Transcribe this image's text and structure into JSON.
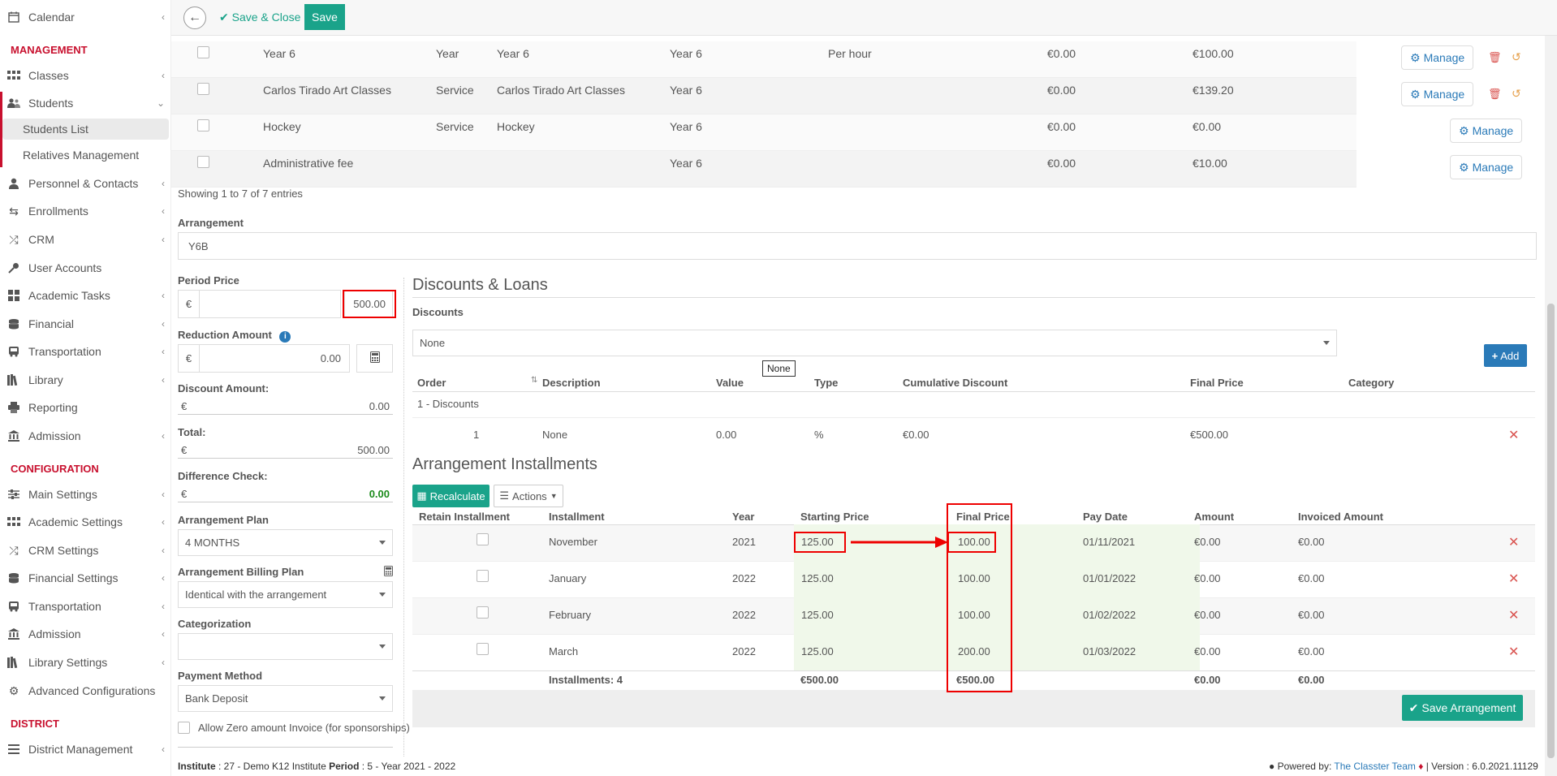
{
  "sidebar": {
    "sections": {
      "management": "MANAGEMENT",
      "configuration": "CONFIGURATION",
      "district": "DISTRICT"
    },
    "items": [
      {
        "label": "Calendar",
        "icon": "calendar-icon",
        "chevron": true
      },
      {
        "label": "Classes",
        "icon": "classes-icon",
        "chevron": true
      },
      {
        "label": "Students",
        "icon": "users-icon",
        "chevron": true
      },
      {
        "label": "Personnel & Contacts",
        "icon": "person-icon",
        "chevron": true
      },
      {
        "label": "Enrollments",
        "icon": "exchange-icon",
        "chevron": true
      },
      {
        "label": "CRM",
        "icon": "shuffle-icon",
        "chevron": true
      },
      {
        "label": "User Accounts",
        "icon": "key-icon",
        "chevron": false
      },
      {
        "label": "Academic Tasks",
        "icon": "grid-icon",
        "chevron": true
      },
      {
        "label": "Financial",
        "icon": "coins-icon",
        "chevron": true
      },
      {
        "label": "Transportation",
        "icon": "bus-icon",
        "chevron": true
      },
      {
        "label": "Library",
        "icon": "library-icon",
        "chevron": true
      },
      {
        "label": "Reporting",
        "icon": "printer-icon",
        "chevron": false
      },
      {
        "label": "Admission",
        "icon": "bank-icon",
        "chevron": true
      },
      {
        "label": "Main Settings",
        "icon": "sliders-icon",
        "chevron": true
      },
      {
        "label": "Academic Settings",
        "icon": "grid-icon",
        "chevron": true
      },
      {
        "label": "CRM Settings",
        "icon": "shuffle-icon",
        "chevron": true
      },
      {
        "label": "Financial Settings",
        "icon": "coins-icon",
        "chevron": true
      },
      {
        "label": "Transportation",
        "icon": "bus-icon",
        "chevron": true
      },
      {
        "label": "Admission",
        "icon": "bank-icon",
        "chevron": true
      },
      {
        "label": "Library Settings",
        "icon": "library-icon",
        "chevron": true
      },
      {
        "label": "Advanced Configurations",
        "icon": "gears-icon",
        "chevron": false
      },
      {
        "label": "District Management",
        "icon": "menu-icon",
        "chevron": true
      }
    ],
    "students_sub": [
      "Students List",
      "Relatives Management"
    ]
  },
  "toolbar": {
    "save_close": "Save & Close",
    "save": "Save"
  },
  "services_table": {
    "rows": [
      {
        "name": "Year 6",
        "type": "Year",
        "desc": "Year 6",
        "level": "Year 6",
        "unit": "Per hour",
        "price1": "€0.00",
        "price2": "€100.00",
        "actions": true
      },
      {
        "name": "Carlos Tirado Art Classes",
        "type": "Service",
        "desc": "Carlos Tirado Art Classes",
        "level": "Year 6",
        "unit": "",
        "price1": "€0.00",
        "price2": "€139.20",
        "actions": true
      },
      {
        "name": "Hockey",
        "type": "Service",
        "desc": "Hockey",
        "level": "Year 6",
        "unit": "",
        "price1": "€0.00",
        "price2": "€0.00",
        "actions": false
      },
      {
        "name": "Administrative fee",
        "type": "",
        "desc": "",
        "level": "Year 6",
        "unit": "",
        "price1": "€0.00",
        "price2": "€10.00",
        "actions": false
      }
    ],
    "manage_label": "Manage",
    "showing": "Showing 1 to 7 of 7 entries"
  },
  "arrangement": {
    "label": "Arrangement",
    "value": "Y6B"
  },
  "left_form": {
    "period_price_label": "Period Price",
    "period_price": "500.00",
    "currency": "€",
    "reduction_label": "Reduction Amount",
    "reduction": "0.00",
    "discount_amount_label": "Discount Amount:",
    "discount_amount": "0.00",
    "total_label": "Total:",
    "total": "500.00",
    "difference_label": "Difference Check:",
    "difference": "0.00",
    "plan_label": "Arrangement Plan",
    "plan": "4 MONTHS",
    "billing_label": "Arrangement Billing Plan",
    "billing": "Identical with the arrangement",
    "categorization_label": "Categorization",
    "categorization": "",
    "payment_label": "Payment Method",
    "payment": "Bank Deposit",
    "zero_invoice": "Allow Zero amount Invoice (for sponsorships)"
  },
  "discounts": {
    "title": "Discounts & Loans",
    "label": "Discounts",
    "selected": "None",
    "tooltip": "None",
    "add": "Add",
    "headers": [
      "Order",
      "Description",
      "Value",
      "Type",
      "Cumulative Discount",
      "Final Price",
      "Category"
    ],
    "group": "1 - Discounts",
    "row": {
      "order": "1",
      "desc": "None",
      "value": "0.00",
      "type": "%",
      "cumulative": "€0.00",
      "final": "€500.00"
    }
  },
  "installments": {
    "title": "Arrangement Installments",
    "recalculate": "Recalculate",
    "actions": "Actions",
    "headers": [
      "Retain Installment",
      "Installment",
      "Year",
      "Starting Price",
      "Final Price",
      "Pay Date",
      "Amount",
      "Invoiced Amount"
    ],
    "rows": [
      {
        "name": "November",
        "year": "2021",
        "start": "125.00",
        "final": "100.00",
        "date": "01/11/2021",
        "amount": "€0.00",
        "invoiced": "€0.00"
      },
      {
        "name": "January",
        "year": "2022",
        "start": "125.00",
        "final": "100.00",
        "date": "01/01/2022",
        "amount": "€0.00",
        "invoiced": "€0.00"
      },
      {
        "name": "February",
        "year": "2022",
        "start": "125.00",
        "final": "100.00",
        "date": "01/02/2022",
        "amount": "€0.00",
        "invoiced": "€0.00"
      },
      {
        "name": "March",
        "year": "2022",
        "start": "125.00",
        "final": "200.00",
        "date": "01/03/2022",
        "amount": "€0.00",
        "invoiced": "€0.00"
      }
    ],
    "totals": {
      "label": "Installments: 4",
      "start": "€500.00",
      "final": "€500.00",
      "amount": "€0.00",
      "invoiced": "€0.00"
    },
    "save": "Save Arrangement"
  },
  "footer": {
    "institute_label": "Institute",
    "institute": " : 27 - Demo K12 Institute ",
    "period_label": "Period",
    "period": " : 5 - Year 2021 - 2022",
    "powered": "Powered by:",
    "team": "The Classter Team",
    "version": "| Version : 6.0.2021.11129"
  },
  "colors": {
    "accent": "#1aa38a",
    "brand_red": "#c8102e",
    "link_blue": "#2a7ab8",
    "highlight_red": "#ee0000"
  }
}
